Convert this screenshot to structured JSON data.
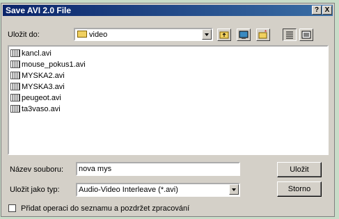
{
  "title": "Save AVI 2.0 File",
  "title_buttons": {
    "help": "?",
    "close": "X"
  },
  "save_in": {
    "label": "Uložit do:",
    "value": "video"
  },
  "toolbar": {
    "up": "up-folder-icon",
    "desktop": "desktop-icon",
    "new_folder": "new-folder-icon",
    "list_view": "list-view-icon",
    "details_view": "details-view-icon"
  },
  "files": [
    "kancl.avi",
    "mouse_pokus1.avi",
    "MYSKA2.avi",
    "MYSKA3.avi",
    "peugeot.avi",
    "ta3vaso.avi"
  ],
  "filename": {
    "label": "Název souboru:",
    "value": "nova mys"
  },
  "filetype": {
    "label": "Uložit jako typ:",
    "value": "Audio-Video Interleave (*.avi)"
  },
  "buttons": {
    "save": "Uložit",
    "cancel": "Storno"
  },
  "checkbox": {
    "label": "Přidat operaci do seznamu a pozdržet zpracování",
    "checked": false
  }
}
